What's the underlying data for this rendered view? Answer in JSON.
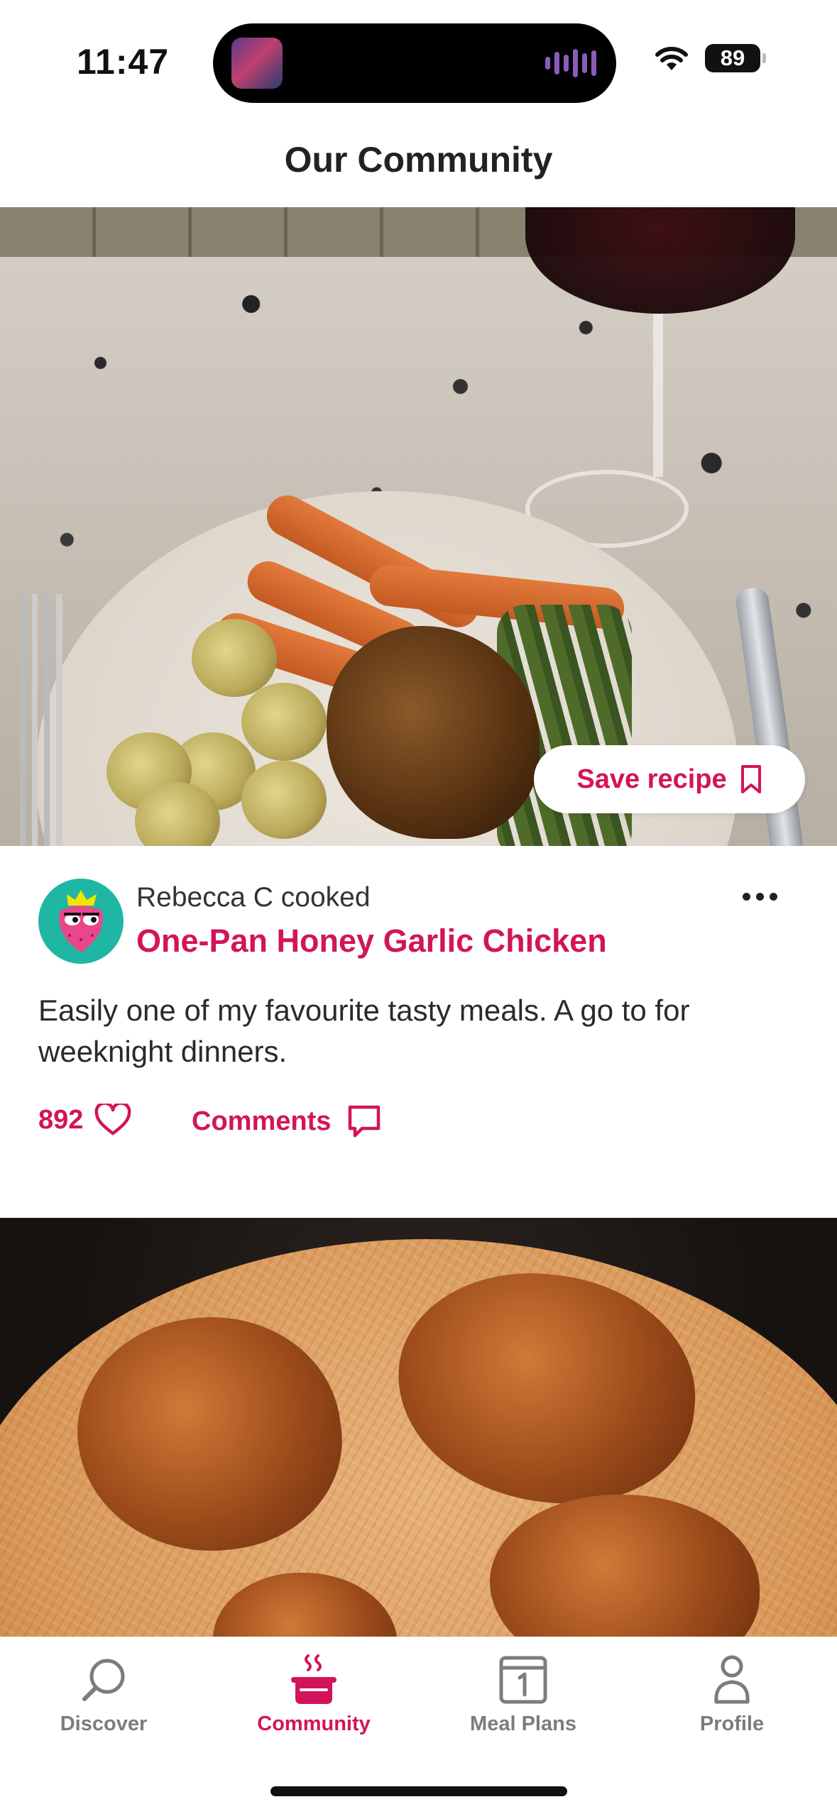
{
  "status_bar": {
    "time": "11:47",
    "battery": "89"
  },
  "header": {
    "title": "Our Community"
  },
  "post": {
    "save_label": "Save recipe",
    "author_line": "Rebecca C cooked",
    "recipe_title": "One-Pan Honey Garlic Chicken",
    "caption": "Easily one of my favourite tasty meals. A go to for weeknight dinners.",
    "likes_count": "892",
    "comments_label": "Comments"
  },
  "tabs": [
    {
      "label": "Discover",
      "icon": "search-icon",
      "active": false
    },
    {
      "label": "Community",
      "icon": "cooking-pot-icon",
      "active": true
    },
    {
      "label": "Meal Plans",
      "icon": "calendar-icon",
      "active": false
    },
    {
      "label": "Profile",
      "icon": "person-icon",
      "active": false
    }
  ],
  "colors": {
    "accent": "#d3145a",
    "inactive": "#7c7c7c",
    "avatar_bg": "#1fb7a4"
  }
}
